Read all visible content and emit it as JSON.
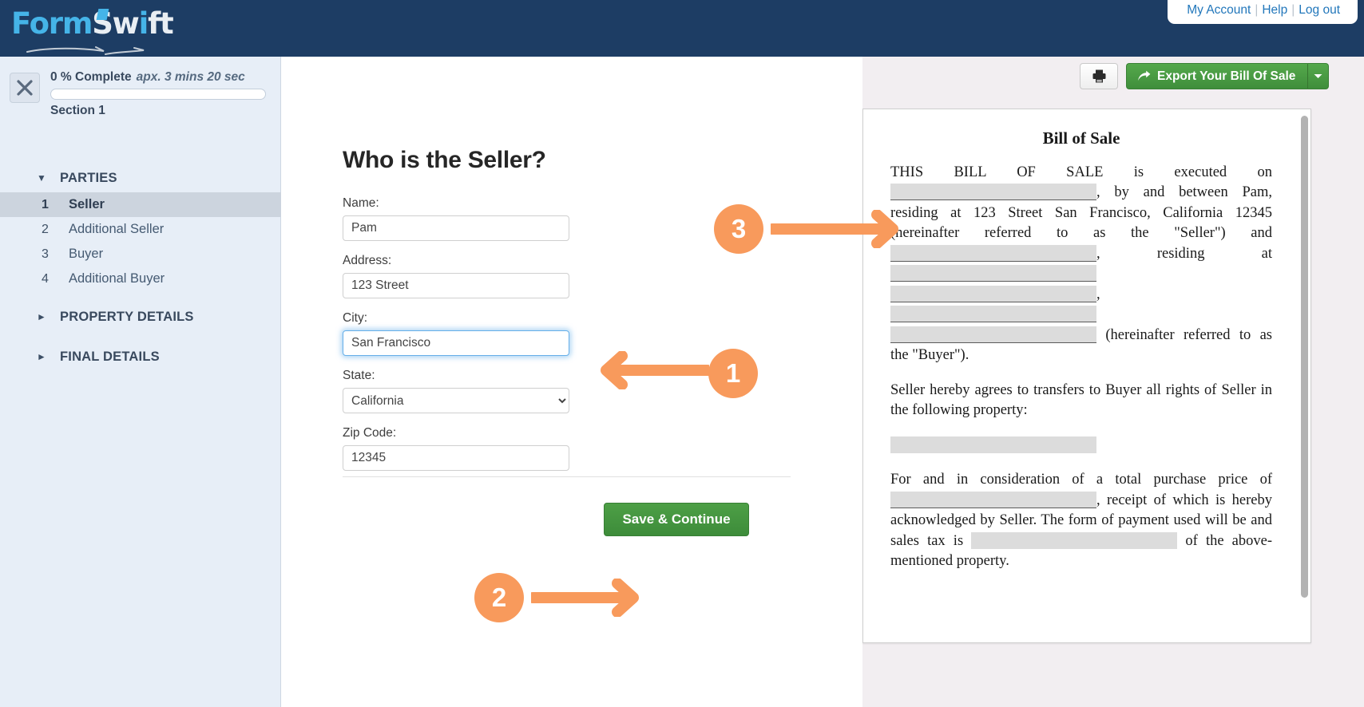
{
  "brand": {
    "logo_form": "Form",
    "logo_sw": "Sw",
    "logo_i": "i",
    "logo_ft": "ft",
    "accent_blue": "#45b4e8",
    "header_navy": "#1d3d64",
    "accent_orange": "#f89a5c",
    "accent_green": "#4d9f46"
  },
  "account_nav": {
    "my_account": "My Account",
    "help": "Help",
    "logout": "Log out",
    "separator": "|"
  },
  "sidebar": {
    "close_icon": "close-icon",
    "progress_percent": "0 % Complete",
    "progress_eta": "apx. 3 mins 20 sec",
    "progress_value": 0,
    "section_label": "Section 1",
    "groups": [
      {
        "label": "PARTIES",
        "expanded": true,
        "caret": "▼",
        "items": [
          {
            "num": "1",
            "label": "Seller",
            "active": true
          },
          {
            "num": "2",
            "label": "Additional Seller",
            "active": false
          },
          {
            "num": "3",
            "label": "Buyer",
            "active": false
          },
          {
            "num": "4",
            "label": "Additional Buyer",
            "active": false
          }
        ]
      },
      {
        "label": "PROPERTY DETAILS",
        "expanded": false,
        "caret": "►",
        "items": []
      },
      {
        "label": "FINAL DETAILS",
        "expanded": false,
        "caret": "►",
        "items": []
      }
    ]
  },
  "form": {
    "title": "Who is the Seller?",
    "fields": [
      {
        "label": "Name:",
        "value": "Pam",
        "type": "text",
        "focused": false
      },
      {
        "label": "Address:",
        "value": "123 Street",
        "type": "text",
        "focused": false
      },
      {
        "label": "City:",
        "value": "San Francisco",
        "type": "text",
        "focused": true
      },
      {
        "label": "State:",
        "value": "California",
        "type": "select",
        "focused": false
      },
      {
        "label": "Zip Code:",
        "value": "12345",
        "type": "text",
        "focused": false
      }
    ],
    "state_options": [
      "California"
    ],
    "save_button": "Save & Continue"
  },
  "toolbar": {
    "print_icon": "printer-icon",
    "export_icon": "share-arrow-icon",
    "export_label": "Export Your Bill Of Sale",
    "export_caret": "▾"
  },
  "document": {
    "title": "Bill of Sale",
    "p1_a": "THIS BILL OF SALE is executed on",
    "p1_b": ", by and between Pam, residing at 123 Street San Francisco, California 12345 (hereinafter referred to as the \"Seller\") and",
    "p1_c": ",",
    "p1_d": "residing at",
    "p1_e": ",",
    "p1_f": "(hereinafter referred to as the \"Buyer\").",
    "p2": "Seller hereby agrees to transfers to Buyer all rights of Seller in the following property:",
    "p3_a": "For and in consideration of a total purchase price of",
    "p3_b": ", receipt of which is hereby acknowledged by Seller. The form of payment used will be and sales tax is",
    "p3_c": "of the above-mentioned property."
  },
  "annotations": [
    {
      "number": "1",
      "target": "city-input",
      "direction": "left"
    },
    {
      "number": "2",
      "target": "save-continue-button",
      "direction": "right"
    },
    {
      "number": "3",
      "target": "document-preview",
      "direction": "right"
    }
  ]
}
